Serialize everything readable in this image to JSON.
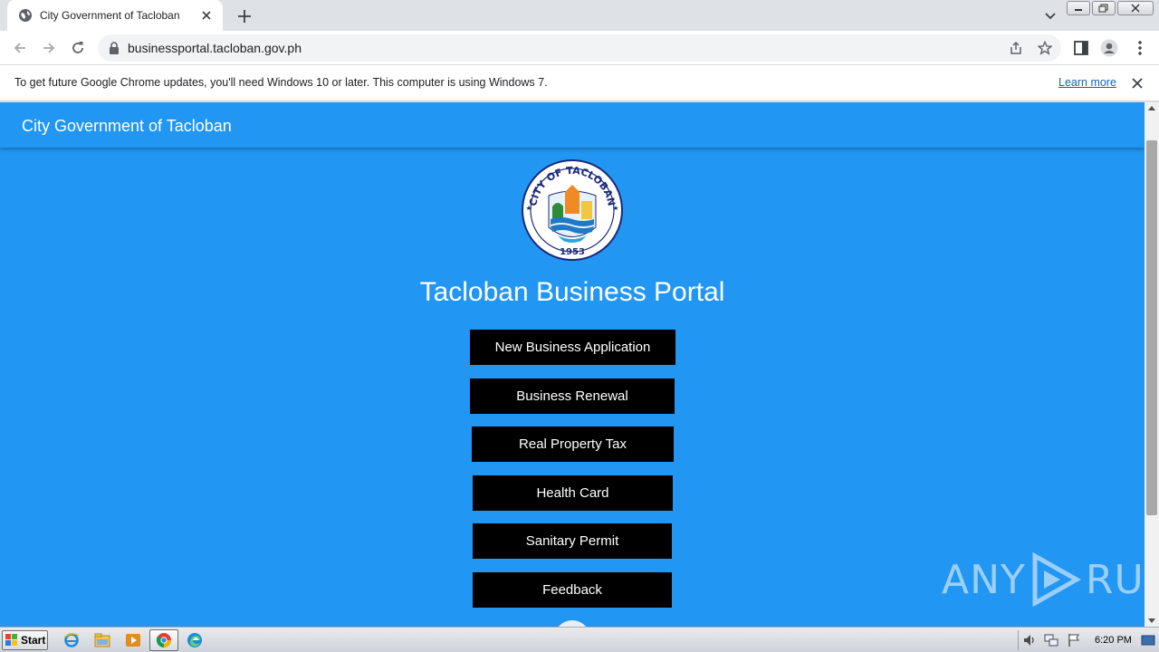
{
  "browser": {
    "tab_title": "City Government of Tacloban",
    "url": "businessportal.tacloban.gov.ph"
  },
  "infobar": {
    "message": "To get future Google Chrome updates, you'll need Windows 10 or later. This computer is using Windows 7.",
    "link_label": "Learn more"
  },
  "page": {
    "header_title": "City Government of Tacloban",
    "portal_title": "Tacloban Business Portal",
    "seal": {
      "top_text": "CITY OF TACLOBAN",
      "year": "1953"
    },
    "menu": [
      "New Business Application",
      "Business Renewal",
      "Real Property Tax",
      "Health Card",
      "Sanitary Permit",
      "Feedback"
    ],
    "colors": {
      "primary": "#2196f3",
      "button": "#000000",
      "text": "#ffffff"
    }
  },
  "watermark": {
    "text_left": "ANY",
    "text_right": "RUN"
  },
  "taskbar": {
    "start_label": "Start",
    "clock": "6:20 PM"
  }
}
